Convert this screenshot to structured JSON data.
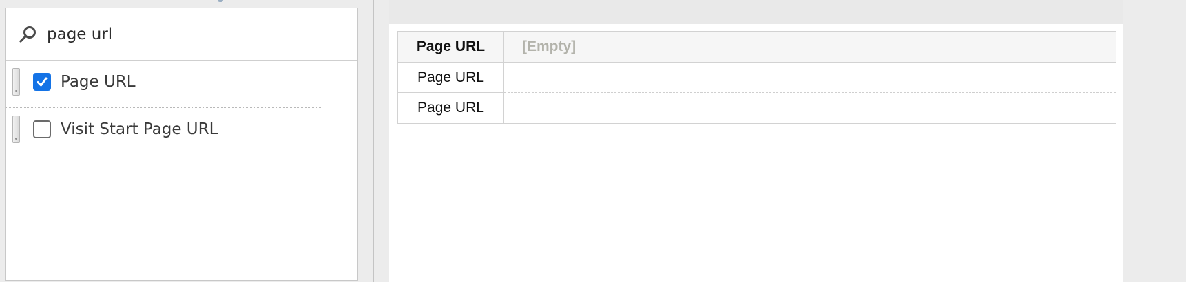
{
  "search": {
    "value": "page url",
    "icon": "search-icon"
  },
  "list": {
    "items": [
      {
        "label": "Page URL",
        "checked": true
      },
      {
        "label": "Visit Start Page URL",
        "checked": false
      }
    ]
  },
  "table": {
    "header": {
      "key": "Page URL",
      "value": "[Empty]"
    },
    "rows": [
      {
        "key": "Page URL",
        "value": ""
      },
      {
        "key": "Page URL",
        "value": ""
      }
    ]
  },
  "colors": {
    "accent": "#1473e6",
    "placeholder": "#b3b3ab"
  }
}
